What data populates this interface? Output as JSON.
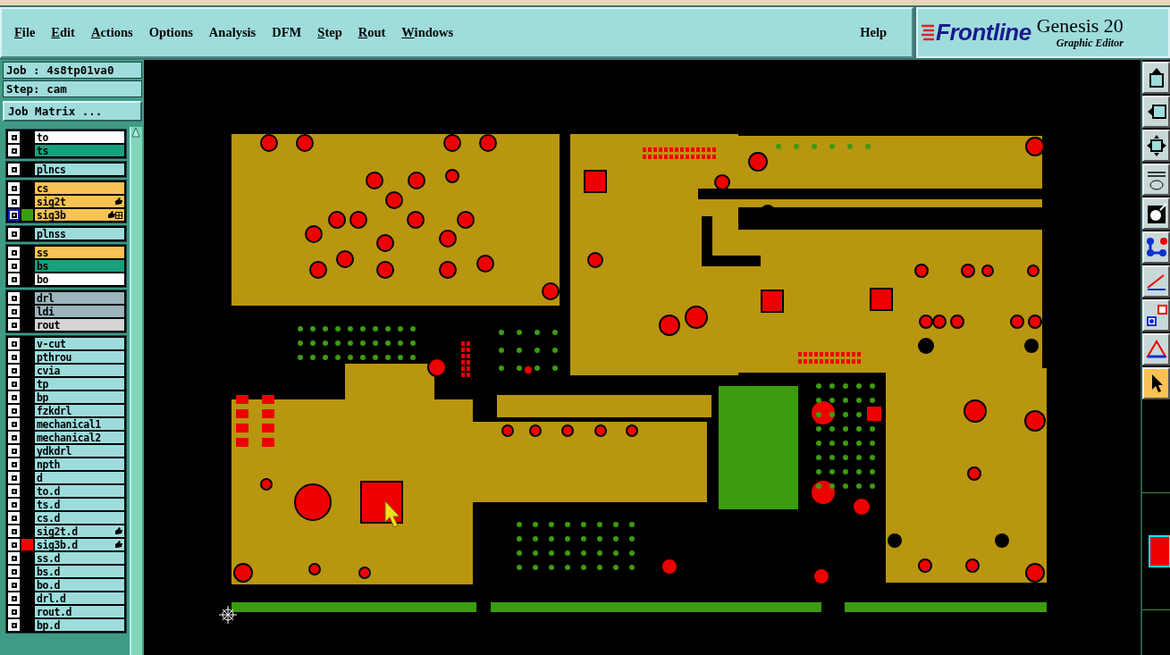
{
  "menu": [
    {
      "label": "File",
      "mnemonic": true
    },
    {
      "label": "Edit",
      "mnemonic": true
    },
    {
      "label": "Actions",
      "mnemonic": true
    },
    {
      "label": "Options",
      "mnemonic": false
    },
    {
      "label": "Analysis",
      "mnemonic": false
    },
    {
      "label": "DFM",
      "mnemonic": false
    },
    {
      "label": "Step",
      "mnemonic": true
    },
    {
      "label": "Rout",
      "mnemonic": true
    },
    {
      "label": "Windows",
      "mnemonic": true
    }
  ],
  "help": {
    "label": "Help"
  },
  "brand": {
    "logo": "Frontline",
    "product": "Genesis 20",
    "subtitle": "Graphic Editor"
  },
  "job": {
    "label": "Job : 4s8tp01va0"
  },
  "step": {
    "label": "Step: cam"
  },
  "job_matrix": {
    "label": "Job Matrix ..."
  },
  "layer_groups": [
    [
      {
        "name": "to",
        "color": "#ffffff",
        "selected": false,
        "locked": false,
        "grid": false
      },
      {
        "name": "ts",
        "color": "#18a07c",
        "selected": false,
        "locked": false,
        "grid": false
      }
    ],
    [
      {
        "name": "plncs",
        "color": "#9edcdc",
        "selected": false,
        "locked": false,
        "grid": false
      }
    ],
    [
      {
        "name": "cs",
        "color": "#f8c254",
        "selected": false,
        "locked": false,
        "grid": false
      },
      {
        "name": "sig2t",
        "color": "#f8c254",
        "selected": false,
        "locked": true,
        "grid": false
      },
      {
        "name": "sig3b",
        "color": "#f8c254",
        "selected": true,
        "locked": true,
        "grid": true,
        "marker": {
          "color": "#3c9c10"
        }
      }
    ],
    [
      {
        "name": "plnss",
        "color": "#9edcdc",
        "selected": false,
        "locked": false,
        "grid": false
      }
    ],
    [
      {
        "name": "ss",
        "color": "#f8c254",
        "selected": false,
        "locked": false,
        "grid": false
      },
      {
        "name": "bs",
        "color": "#18a07c",
        "selected": false,
        "locked": false,
        "grid": false
      },
      {
        "name": "bo",
        "color": "#ffffff",
        "selected": false,
        "locked": false,
        "grid": false
      }
    ],
    [
      {
        "name": "drl",
        "color": "#9cb4bc",
        "selected": false,
        "locked": false,
        "grid": false
      },
      {
        "name": "ldi",
        "color": "#9cb4bc",
        "selected": false,
        "locked": false,
        "grid": false
      },
      {
        "name": "rout",
        "color": "#d4d4d4",
        "selected": false,
        "locked": false,
        "grid": false
      }
    ],
    [
      {
        "name": "v-cut",
        "color": "#9edcdc",
        "selected": false,
        "locked": false,
        "grid": false
      },
      {
        "name": "pthrou",
        "color": "#9edcdc",
        "selected": false,
        "locked": false,
        "grid": false
      },
      {
        "name": "cvia",
        "color": "#9edcdc",
        "selected": false,
        "locked": false,
        "grid": false
      },
      {
        "name": "tp",
        "color": "#9edcdc",
        "selected": false,
        "locked": false,
        "grid": false
      },
      {
        "name": "bp",
        "color": "#9edcdc",
        "selected": false,
        "locked": false,
        "grid": false
      },
      {
        "name": "fzkdrl",
        "color": "#9edcdc",
        "selected": false,
        "locked": false,
        "grid": false
      },
      {
        "name": "mechanical1",
        "color": "#9edcdc",
        "selected": false,
        "locked": false,
        "grid": false
      },
      {
        "name": "mechanical2",
        "color": "#9edcdc",
        "selected": false,
        "locked": false,
        "grid": false
      },
      {
        "name": "ydkdrl",
        "color": "#9edcdc",
        "selected": false,
        "locked": false,
        "grid": false
      },
      {
        "name": "npth",
        "color": "#9edcdc",
        "selected": false,
        "locked": false,
        "grid": false
      },
      {
        "name": "d",
        "color": "#9edcdc",
        "selected": false,
        "locked": false,
        "grid": false
      },
      {
        "name": "to.d",
        "color": "#9edcdc",
        "selected": false,
        "locked": false,
        "grid": false
      },
      {
        "name": "ts.d",
        "color": "#9edcdc",
        "selected": false,
        "locked": false,
        "grid": false
      },
      {
        "name": "cs.d",
        "color": "#9edcdc",
        "selected": false,
        "locked": false,
        "grid": false
      },
      {
        "name": "sig2t.d",
        "color": "#9edcdc",
        "selected": false,
        "locked": true,
        "grid": false
      },
      {
        "name": "sig3b.d",
        "color": "#9edcdc",
        "selected": false,
        "locked": true,
        "grid": false,
        "marker": {
          "color": "#ff0000"
        }
      },
      {
        "name": "ss.d",
        "color": "#9edcdc",
        "selected": false,
        "locked": false,
        "grid": false
      },
      {
        "name": "bs.d",
        "color": "#9edcdc",
        "selected": false,
        "locked": false,
        "grid": false
      },
      {
        "name": "bo.d",
        "color": "#9edcdc",
        "selected": false,
        "locked": false,
        "grid": false
      },
      {
        "name": "drl.d",
        "color": "#9edcdc",
        "selected": false,
        "locked": false,
        "grid": false
      },
      {
        "name": "rout.d",
        "color": "#9edcdc",
        "selected": false,
        "locked": false,
        "grid": false
      },
      {
        "name": "bp.d",
        "color": "#9edcdc",
        "selected": false,
        "locked": false,
        "grid": false
      }
    ]
  ],
  "tools": [
    {
      "kind": "up",
      "selected": false
    },
    {
      "kind": "left",
      "selected": false
    },
    {
      "kind": "fit",
      "selected": false
    },
    {
      "kind": "measure",
      "selected": false
    },
    {
      "kind": "pad",
      "selected": false
    },
    {
      "kind": "route",
      "selected": false
    },
    {
      "kind": "angle",
      "selected": false
    },
    {
      "kind": "snap",
      "selected": false
    },
    {
      "kind": "triangle",
      "selected": false
    },
    {
      "kind": "pointer",
      "selected": true
    }
  ]
}
